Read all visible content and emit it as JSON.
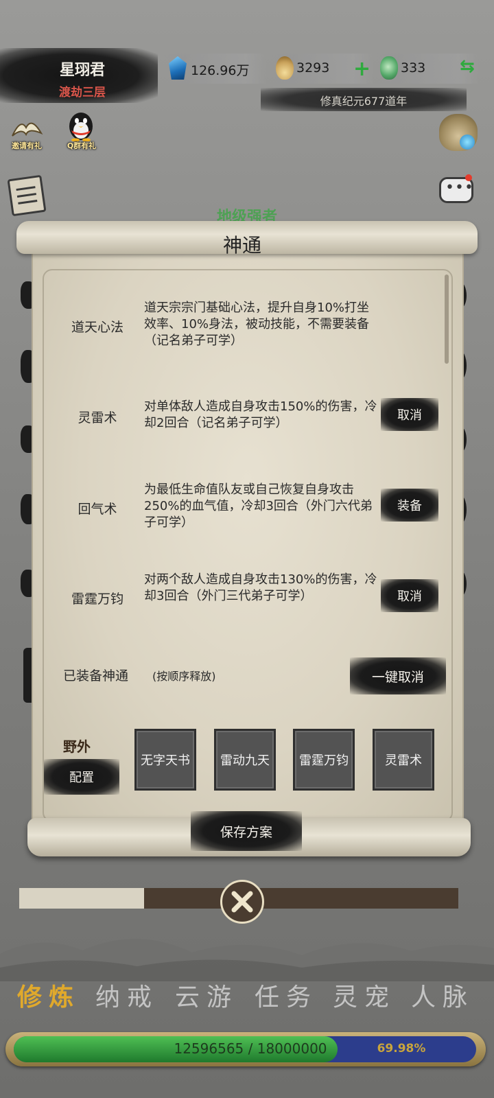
{
  "header": {
    "player_name": "星珝君",
    "realm": "渡劫三层",
    "spirit_stones": "126.96万",
    "gourd_count": "3293",
    "jade_count": "333",
    "era": "修真纪元677道年"
  },
  "side_buttons": {
    "invite": "邀请有礼",
    "qq_group": "Q群有礼"
  },
  "background_banner": "地级强者",
  "modal": {
    "title": "神通",
    "skills": [
      {
        "name": "道天心法",
        "desc": "道天宗宗门基础心法，提升自身10%打坐效率、10%身法，被动技能，不需要装备（记名弟子可学）",
        "action": ""
      },
      {
        "name": "灵雷术",
        "desc": "对单体敌人造成自身攻击150%的伤害，冷却2回合（记名弟子可学）",
        "action": "取消"
      },
      {
        "name": "回气术",
        "desc": "为最低生命值队友或自己恢复自身攻击250%的血气值，冷却3回合（外门六代弟子可学）",
        "action": "装备"
      },
      {
        "name": "雷霆万钧",
        "desc": "对两个敌人造成自身攻击130%的伤害，冷却3回合（外门三代弟子可学）",
        "action": "取消"
      }
    ],
    "equipped_label": "已装备神通",
    "equipped_note": "(按顺序释放)",
    "cancel_all": "一键取消",
    "field_label": "野外",
    "config_button": "配置",
    "slots": [
      "无字天书",
      "雷动九天",
      "雷霆万钧",
      "灵雷术"
    ],
    "save_button": "保存方案"
  },
  "bottom_nav": [
    "修炼",
    "纳戒",
    "云游",
    "任务",
    "灵宠",
    "人脉"
  ],
  "active_nav_index": 0,
  "experience": {
    "text": "12596565 / 18000000",
    "percent": "69.98%",
    "fraction": 0.6998
  },
  "colors": {
    "active_nav": "#e0a92c",
    "realm": "#d9554a",
    "currency_plus": "#2faa3e",
    "exp_fill": "#2d9a3a"
  }
}
